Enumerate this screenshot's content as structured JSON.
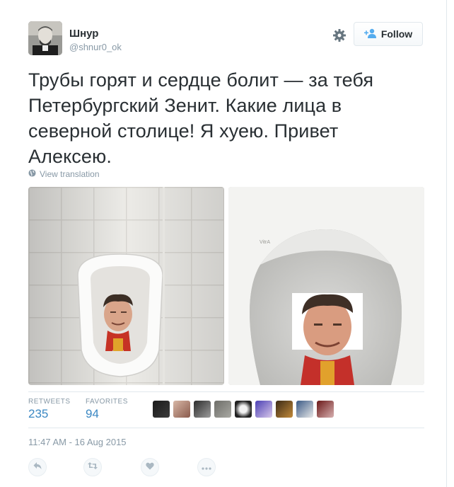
{
  "author": {
    "name": "Шнур",
    "handle": "@shnur0_ok"
  },
  "follow_button": {
    "label": "Follow"
  },
  "tweet": {
    "text": "Трубы горят и сердце болит — за тебя Петербургский Зенит. Какие лица в северной столице! Я хуею. Привет Алексею.",
    "translate_label": "View translation",
    "timestamp": "11:47 AM - 16 Aug 2015"
  },
  "stats": {
    "retweets_label": "RETWEETS",
    "retweets_value": "235",
    "favorites_label": "FAVORITES",
    "favorites_value": "94"
  },
  "photos": {
    "right_brand": "VitrA"
  },
  "colors": {
    "link": "#3b88c3",
    "muted": "#8899a6",
    "text": "#292f33",
    "border": "#e1e8ed"
  },
  "icons": [
    "gear-icon",
    "follow-person-icon",
    "globe-icon",
    "reply-icon",
    "retweet-icon",
    "heart-icon",
    "more-icon"
  ]
}
